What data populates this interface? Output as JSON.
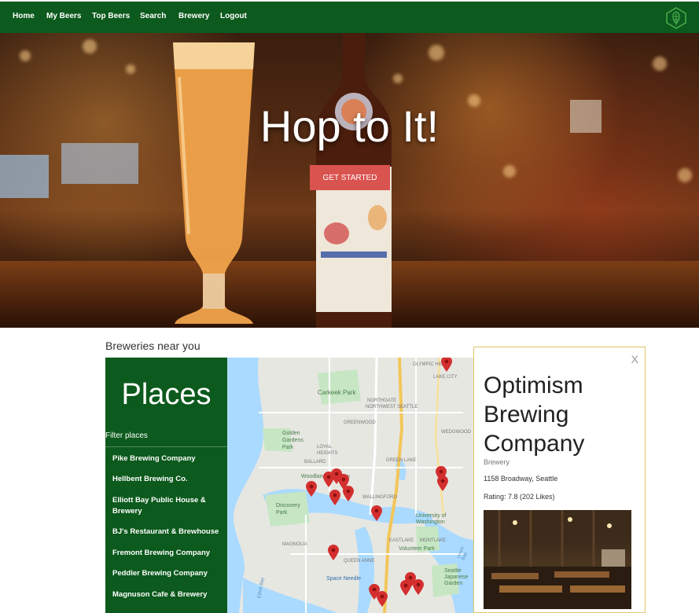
{
  "nav": {
    "items": [
      "Home",
      "My Beers",
      "Top Beers",
      "Search",
      "Brewery",
      "Logout"
    ],
    "logo_icon": "hop-icon"
  },
  "hero": {
    "title": "Hop to It!",
    "cta_label": "GET STARTED"
  },
  "section": {
    "label": "Breweries near you"
  },
  "places": {
    "title": "Places",
    "filter_label": "Filter places",
    "items": [
      "Pike Brewing Company",
      "Hellbent Brewing Co.",
      "Elliott Bay Public House & Brewery",
      "BJ's Restaurant & Brewhouse",
      "Fremont Brewing Company",
      "Peddler Brewing Company",
      "Magnuson Cafe & Brewery"
    ]
  },
  "map": {
    "labels": {
      "carkeek": "Carkeek Park",
      "northgate": "NORTHGATE",
      "north_seattle": "NORTHWEST SEATTLE",
      "golden": "Golden Gardens Park",
      "greenwood": "GREENWOOD",
      "wedgwood": "WEDGWOOD",
      "lake_city": "LAKE CITY",
      "olympic_hills": "OLYMPIC HILLS",
      "ballard": "BALLARD",
      "loyal_heights": "LOYAL HEIGHTS",
      "green_lake": "GREEN LAKE",
      "woodland": "Woodland Park Zoo",
      "wallingford": "WALLINGFORD",
      "discovery": "Discovery Park",
      "university": "University of Washington",
      "magnolia": "MAGNOLIA",
      "eastlake": "EASTLAKE",
      "montlake": "MONTLAKE",
      "volunteer": "Volunteer Park",
      "queen_anne": "QUEEN ANNE",
      "space_needle": "Space Needle",
      "japanese_garden": "Seattle Japanese Garden",
      "elliott_bay": "Elliott Bay",
      "union": "Union Bay"
    }
  },
  "info": {
    "close_label": "X",
    "name": "Optimism Brewing Company",
    "type": "Brewery",
    "address": "1158 Broadway, Seattle",
    "rating": "Rating: 7.8 (202 Likes)"
  },
  "colors": {
    "brand_green": "#0c5a1d",
    "cta_red": "#d9534f",
    "pin_red": "#d32f2f"
  }
}
